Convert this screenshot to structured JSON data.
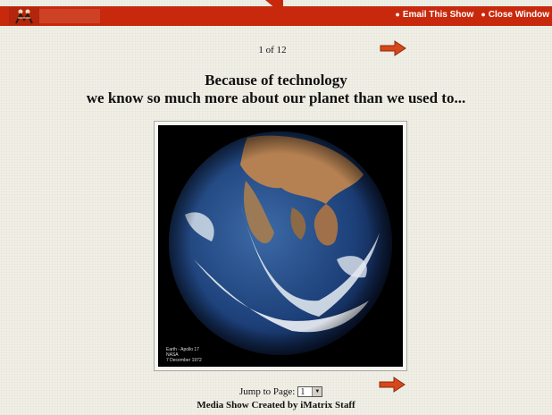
{
  "header": {
    "email_link": "Email This Show",
    "close_link": "Close Window",
    "bar_color": "#c8290d"
  },
  "slide": {
    "counter": "1 of 12",
    "headline_line1": "Because of technology",
    "headline_line2": "we know so much more about our planet than we used to...",
    "image_caption": [
      "Earth - Apollo 17",
      "NASA",
      "7 December 1972"
    ]
  },
  "navigation": {
    "jump_label": "Jump to Page:",
    "selected_page": "1"
  },
  "footer": {
    "credit": "Media Show Created by iMatrix Staff"
  },
  "icons": {
    "next": "right-arrow-icon",
    "logo": "site-logo",
    "dropdown": "chevron-down-icon"
  }
}
